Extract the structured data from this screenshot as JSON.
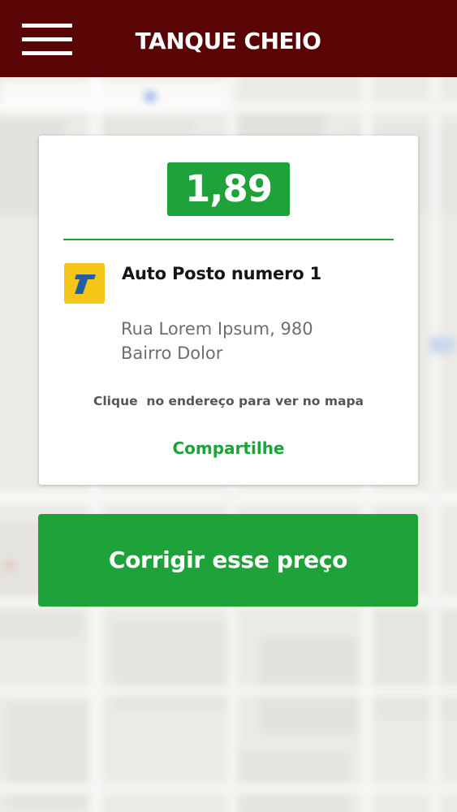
{
  "header": {
    "title": "TANQUE CHEIO",
    "menu_icon": "hamburger-menu-icon"
  },
  "station_card": {
    "price": "1,89",
    "logo_icon": "ipiranga-logo-icon",
    "name": "Auto Posto numero 1",
    "address_line1": "Rua Lorem Ipsum, 980",
    "address_line2": "Bairro Dolor",
    "map_hint": "Clique  no endereço para ver no mapa",
    "share_label": "Compartilhe"
  },
  "actions": {
    "correct_price_label": "Corrigir esse preço"
  },
  "colors": {
    "header_bg": "#5a0505",
    "accent_green": "#1ea23a",
    "logo_yellow": "#f5c518",
    "logo_blue": "#1f5fa8"
  }
}
